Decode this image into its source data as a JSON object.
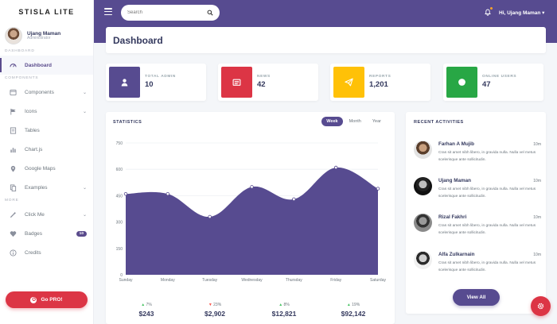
{
  "brand": "STISLA LITE",
  "user": {
    "name": "Ujang Maman",
    "role": "Administrator"
  },
  "sidebar": {
    "headers": [
      "DASHBOARD",
      "COMPONENTS",
      "MORE"
    ],
    "items": [
      {
        "label": "Dashboard",
        "icon": "dashboard-gauge-icon",
        "active": true
      },
      {
        "label": "Components",
        "icon": "window-icon",
        "has_children": true
      },
      {
        "label": "Icons",
        "icon": "flag-icon",
        "has_children": true
      },
      {
        "label": "Tables",
        "icon": "table-icon"
      },
      {
        "label": "Chart.js",
        "icon": "chart-icon"
      },
      {
        "label": "Google Maps",
        "icon": "map-pin-icon"
      },
      {
        "label": "Examples",
        "icon": "copy-icon",
        "has_children": true
      },
      {
        "label": "Click Me",
        "icon": "magic-icon",
        "has_children": true
      },
      {
        "label": "Badges",
        "icon": "heart-icon",
        "badge": "10"
      },
      {
        "label": "Credits",
        "icon": "info-icon"
      }
    ],
    "go_pro": "Go PRO!"
  },
  "topbar": {
    "search_placeholder": "Search",
    "user_label": "Hi, Ujang Maman ▾"
  },
  "page_title": "Dashboard",
  "stats": [
    {
      "label": "TOTAL ADMIN",
      "value": "10",
      "color": "#574b90",
      "icon": "user-icon"
    },
    {
      "label": "NEWS",
      "value": "42",
      "color": "#dc3545",
      "icon": "newspaper-icon"
    },
    {
      "label": "REPORTS",
      "value": "1,201",
      "color": "#ffc107",
      "icon": "paper-plane-icon"
    },
    {
      "label": "ONLINE USERS",
      "value": "47",
      "color": "#28a745",
      "icon": "circle-icon"
    }
  ],
  "statistics": {
    "title": "STATISTICS",
    "tabs": [
      "Week",
      "Month",
      "Year"
    ],
    "active_tab": "Week",
    "summary": [
      {
        "change": "7%",
        "direction": "up",
        "value": "$243"
      },
      {
        "change": "23%",
        "direction": "down",
        "value": "$2,902"
      },
      {
        "change": "8%",
        "direction": "up",
        "value": "$12,821"
      },
      {
        "change": "19%",
        "direction": "up",
        "value": "$92,142"
      }
    ]
  },
  "chart_data": {
    "type": "area",
    "categories": [
      "Sunday",
      "Monday",
      "Tuesday",
      "Wednesday",
      "Thursday",
      "Friday",
      "Saturday"
    ],
    "values": [
      460,
      460,
      330,
      500,
      430,
      610,
      490
    ],
    "ylim": [
      0,
      750
    ],
    "yticks": [
      "0",
      "150",
      "300",
      "450",
      "600",
      "750"
    ],
    "color": "#574b90",
    "grid": true
  },
  "activities": {
    "title": "RECENT ACTIVITIES",
    "items": [
      {
        "name": "Farhan A Mujib",
        "time": "10m",
        "text": "Cras sit amet nibh libero, in gravida nulla. Nulla vel metus scelerisque ante sollicitudin."
      },
      {
        "name": "Ujang Maman",
        "time": "10m",
        "text": "Cras sit amet nibh libero, in gravida nulla. Nulla vel metus scelerisque ante sollicitudin."
      },
      {
        "name": "Rizal Fakhri",
        "time": "10m",
        "text": "Cras sit amet nibh libero, in gravida nulla. Nulla vel metus scelerisque ante sollicitudin."
      },
      {
        "name": "Alfa Zulkarnain",
        "time": "10m",
        "text": "Cras sit amet nibh libero, in gravida nulla. Nulla vel metus scelerisque ante sollicitudin."
      }
    ],
    "view_all": "View All"
  }
}
